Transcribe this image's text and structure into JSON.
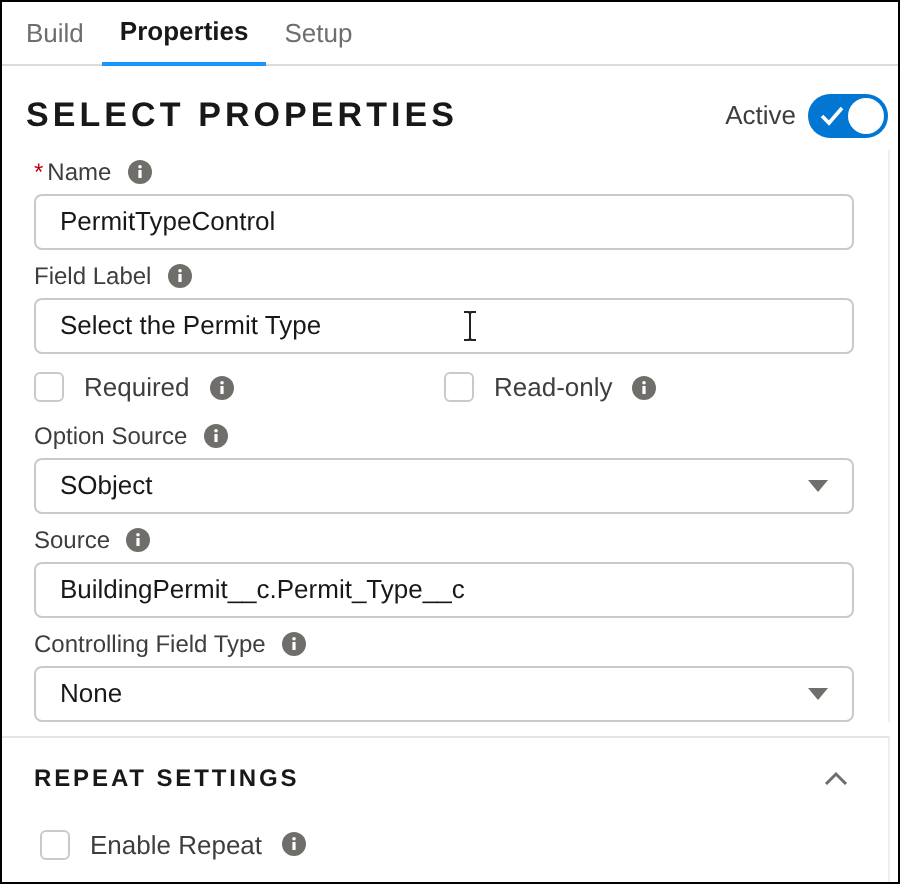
{
  "tabs": [
    {
      "label": "Build",
      "selected": false
    },
    {
      "label": "Properties",
      "selected": true
    },
    {
      "label": "Setup",
      "selected": false
    }
  ],
  "section": {
    "title": "SELECT PROPERTIES",
    "toggle": {
      "label": "Active",
      "on": true
    }
  },
  "fields": [
    {
      "kind": "text",
      "label": "Name",
      "marker": "*",
      "value": "PermitTypeControl"
    },
    {
      "kind": "text",
      "label": "Field Label",
      "value": "Select the Permit Type"
    },
    {
      "kind": "checkboxes",
      "items": [
        {
          "label": "Required",
          "checked": false
        },
        {
          "label": "Read-only",
          "checked": false
        }
      ]
    },
    {
      "kind": "select",
      "label": "Option Source",
      "value": "SObject"
    },
    {
      "kind": "text",
      "label": "Source",
      "value": "BuildingPermit__c.Permit_Type__c"
    },
    {
      "kind": "select",
      "label": "Controlling Field Type",
      "value": "None"
    }
  ],
  "repeat": {
    "title": "REPEAT SETTINGS",
    "expanded": true,
    "items": [
      {
        "label": "Enable Repeat",
        "checked": false
      }
    ]
  }
}
